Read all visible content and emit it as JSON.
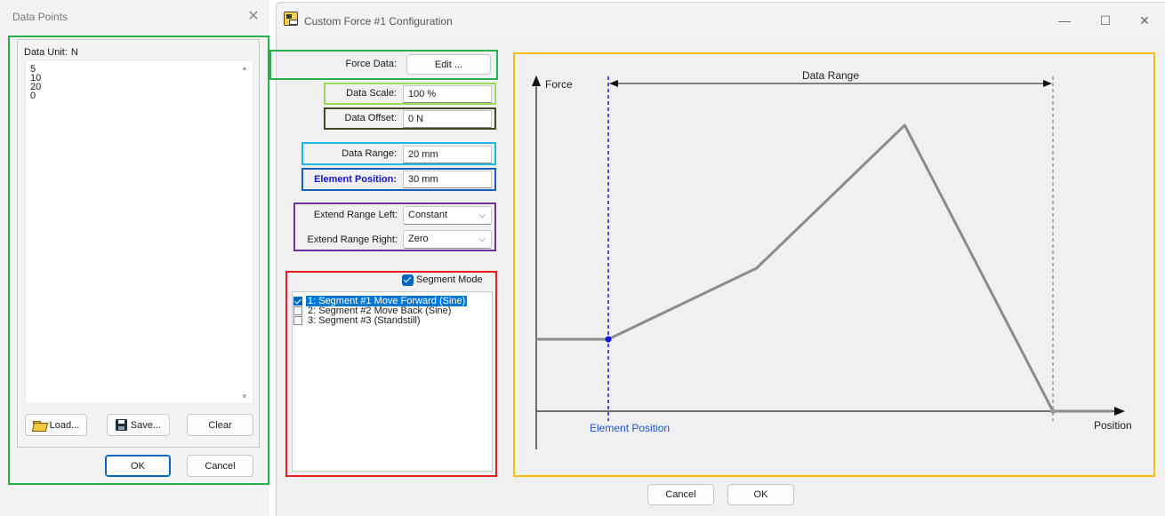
{
  "data_points_dialog": {
    "title": "Data Points",
    "unit_label": "Data Unit:",
    "unit_value": "N",
    "values": [
      "5",
      "10",
      "20",
      "0"
    ],
    "load_label": "Load...",
    "save_label": "Save...",
    "clear_label": "Clear",
    "ok_label": "OK",
    "cancel_label": "Cancel",
    "close_icon": "close-icon"
  },
  "config_window": {
    "title": "Custom Force #1 Configuration",
    "minimize_glyph": "—",
    "maximize_glyph": "☐",
    "close_glyph": "✕",
    "force_data_label": "Force Data:",
    "force_data_button": "Edit ...",
    "data_scale_label": "Data Scale:",
    "data_scale_value": "100 %",
    "data_offset_label": "Data Offset:",
    "data_offset_value": "0 N",
    "data_range_label": "Data Range:",
    "data_range_value": "20 mm",
    "element_position_label": "Element Position:",
    "element_position_value": "30 mm",
    "extend_left_label": "Extend Range Left:",
    "extend_left_value": "Constant",
    "extend_right_label": "Extend Range Right:",
    "extend_right_value": "Zero",
    "segment_mode_label": "Segment Mode",
    "segment_mode_checked": true,
    "segments": [
      {
        "label": "1:  Segment #1 Move Forward (Sine)",
        "checked": true,
        "selected": true
      },
      {
        "label": "2:  Segment #2 Move Back (Sine)",
        "checked": false,
        "selected": false
      },
      {
        "label": "3:  Segment #3 (Standstill)",
        "checked": false,
        "selected": false
      }
    ],
    "cancel_label": "Cancel",
    "ok_label": "OK"
  },
  "highlight_colors": {
    "data_points_frame": "#22b14c",
    "force_data": "#22b14c",
    "data_scale": "#99d95c",
    "data_offset": "#3f4a1e",
    "data_range": "#1eb4e6",
    "element_position": "#1560bd",
    "extend_range": "#7030a0",
    "segments": "#e81d1d",
    "chart": "#f9b81b"
  },
  "chart_data": {
    "type": "line",
    "y_axis_label": "Force",
    "x_axis_label": "Position",
    "range_label": "Data Range",
    "element_position_label": "Element Position",
    "data_values": [
      5,
      10,
      20,
      0
    ],
    "extend_left": "Constant",
    "extend_right": "Zero",
    "line_color": "#8c8c8c",
    "element_marker_color": "#1414e6",
    "range_marker_color": "#9a9a9a"
  }
}
